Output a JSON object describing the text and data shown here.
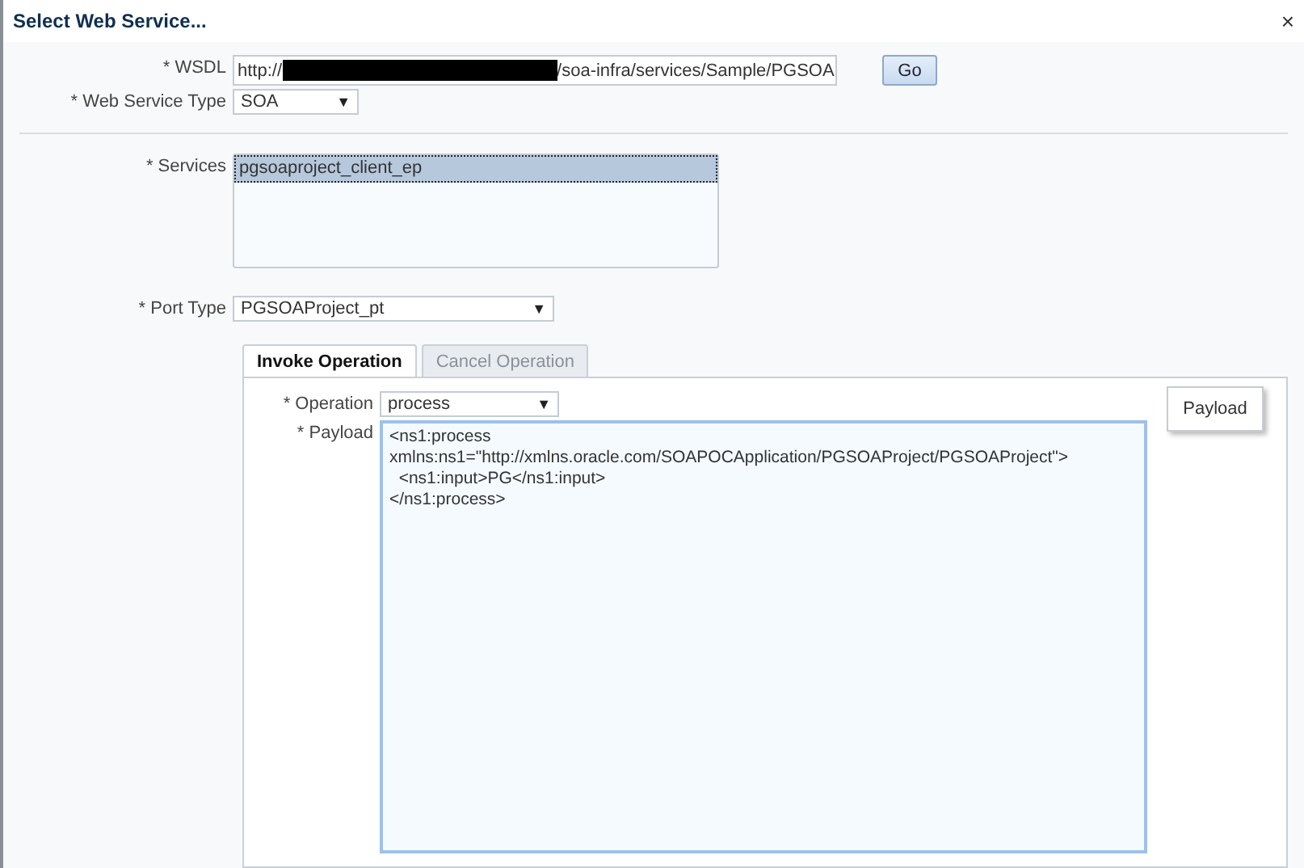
{
  "dialog": {
    "title": "Select Web Service...",
    "close": "×"
  },
  "wsdl": {
    "label": "* WSDL",
    "value_start": "http://",
    "value_end": "/soa-infra/services/Sample/PGSOA",
    "button": "Go"
  },
  "service_type": {
    "label": "* Web Service Type",
    "value": "SOA",
    "arrow": "▼"
  },
  "services": {
    "label": "* Services",
    "items": [
      {
        "name": "pgsoaproject_client_ep",
        "selected": true
      }
    ]
  },
  "port_type": {
    "label": "* Port Type",
    "value": "PGSOAProject_pt",
    "arrow": "▼"
  },
  "tabs": [
    {
      "label": "Invoke Operation",
      "selected": true
    },
    {
      "label": "Cancel Operation",
      "selected": false
    }
  ],
  "operation": {
    "label": "* Operation",
    "value": "process",
    "arrow": "▼"
  },
  "payload": {
    "label": "* Payload",
    "lines": [
      "<ns1:process",
      "xmlns:ns1=\"http://xmlns.oracle.com/SOAPOCApplication/PGSOAProject/PGSOAProject\">",
      "  <ns1:input>PG</ns1:input>",
      "</ns1:process>"
    ],
    "tooltip": "Payload"
  }
}
